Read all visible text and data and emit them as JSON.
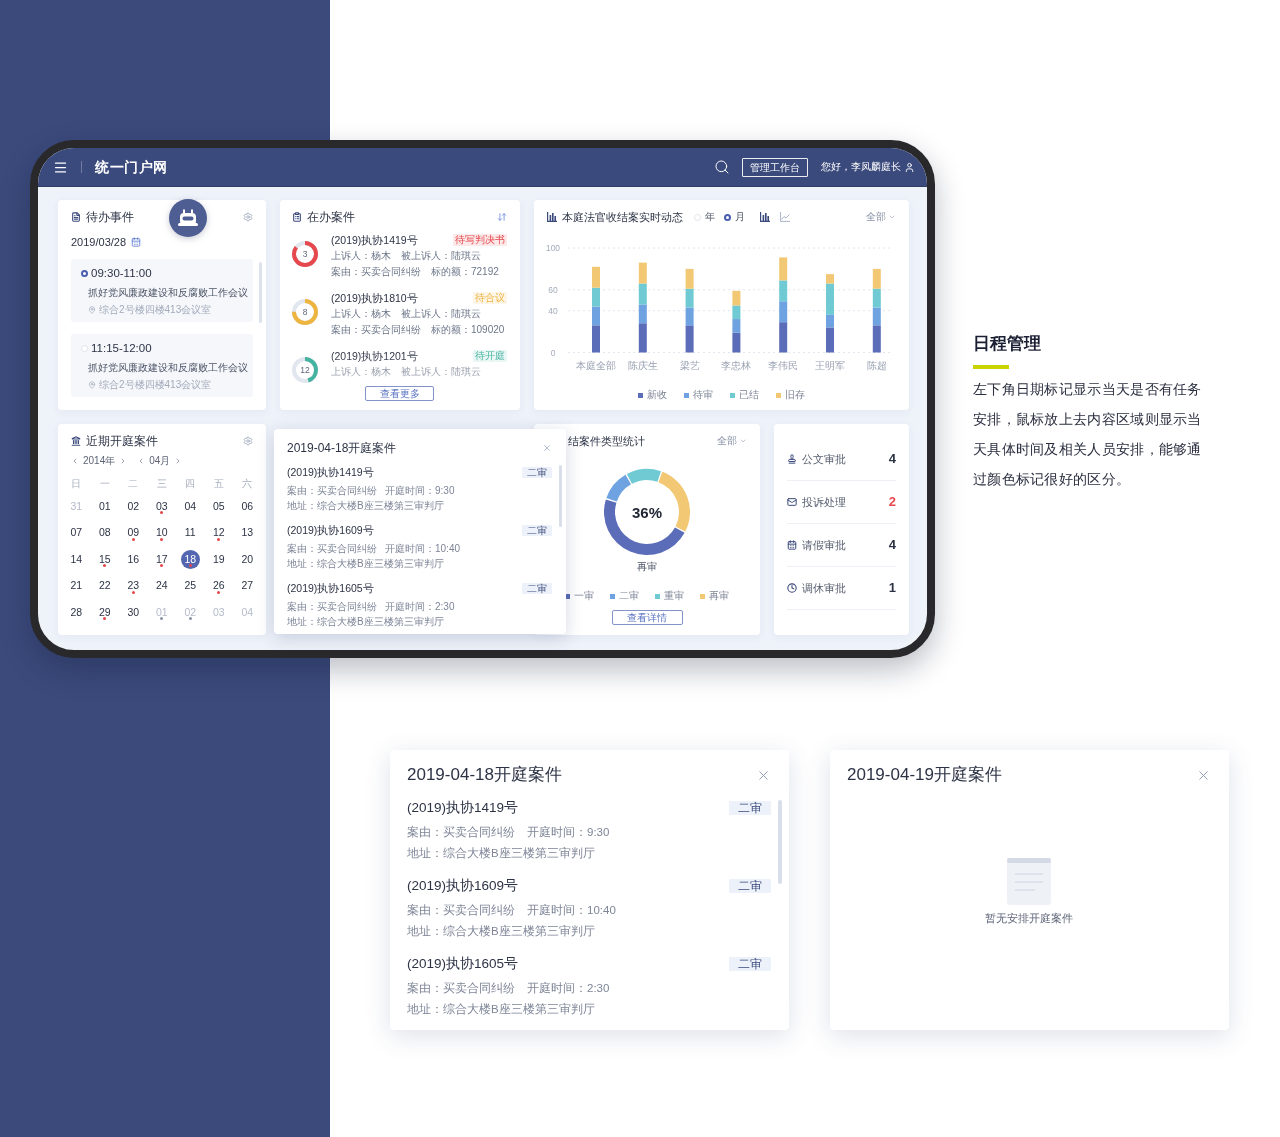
{
  "header": {
    "title": "统一门户网",
    "button": "管理工作台",
    "greeting": "您好，李凤麟庭长"
  },
  "todo": {
    "title": "待办事件",
    "date": "2019/03/28",
    "events": [
      {
        "time": "09:30-11:00",
        "title": "抓好党风廉政建设和反腐败工作会议",
        "location": "综合2号楼四楼413会议室",
        "selected": true
      },
      {
        "time": "11:15-12:00",
        "title": "抓好党风廉政建设和反腐败工作会议",
        "location": "综合2号楼四楼413会议室",
        "selected": false
      }
    ]
  },
  "cases": {
    "title": "在办案件",
    "items": [
      {
        "count": "3",
        "level": 0.85,
        "color": "#e5484d",
        "number": "(2019)执协1419号",
        "status": "待写判决书",
        "appellant": "上诉人：杨木",
        "appellee": "被上诉人：陆琪云",
        "cause": "案由：买卖合同纠纷",
        "amount": "标的额：72192"
      },
      {
        "count": "8",
        "level": 0.75,
        "color": "#eeb440",
        "number": "(2019)执协1810号",
        "status": "待合议",
        "appellant": "上诉人：杨木",
        "appellee": "被上诉人：陆琪云",
        "cause": "案由：买卖合同纠纷",
        "amount": "标的额：109020"
      },
      {
        "count": "12",
        "level": 0.45,
        "color": "#45b3a0",
        "number": "(2019)执协1201号",
        "status": "待开庭",
        "appellant": "上诉人：杨木",
        "appellee": "被上诉人：陆琪云"
      }
    ],
    "more_button": "查看更多"
  },
  "trend": {
    "title": "本庭法官收结案实时动态",
    "periods": [
      {
        "label": "年",
        "selected": false
      },
      {
        "label": "月",
        "selected": true
      }
    ],
    "views": [
      {
        "kind": "bar",
        "selected": true
      },
      {
        "kind": "line",
        "selected": false
      }
    ],
    "filter": "全部",
    "chart_data": {
      "type": "bar",
      "stacked": true,
      "categories": [
        "本庭全部",
        "陈庆生",
        "梁艺",
        "李忠林",
        "李伟民",
        "王明军",
        "陈超"
      ],
      "series": [
        {
          "name": "新收",
          "color": "#5b6cb8",
          "values": [
            26,
            28,
            26,
            19,
            29,
            24,
            26
          ]
        },
        {
          "name": "待审",
          "color": "#6ea2e0",
          "values": [
            18,
            18,
            17,
            13,
            20,
            12,
            17
          ]
        },
        {
          "name": "已结",
          "color": "#6fcad4",
          "values": [
            18,
            20,
            18,
            13,
            20,
            30,
            18
          ]
        },
        {
          "name": "旧存",
          "color": "#f2c874",
          "values": [
            20,
            20,
            19,
            14,
            22,
            9,
            19
          ]
        }
      ],
      "ylim": [
        0,
        100
      ],
      "yticks": [
        0,
        40,
        60,
        100
      ],
      "legend": "bottom"
    }
  },
  "court_calendar": {
    "title": "近期开庭案件",
    "year": "2014年",
    "month": "04月",
    "weekdays": [
      "日",
      "一",
      "二",
      "三",
      "四",
      "五",
      "六"
    ],
    "days": [
      {
        "day": "31",
        "outside": true,
        "marked": false,
        "selected": false
      },
      {
        "day": "01",
        "outside": false,
        "marked": false,
        "selected": false
      },
      {
        "day": "02",
        "outside": false,
        "marked": false,
        "selected": false
      },
      {
        "day": "03",
        "outside": false,
        "marked": true,
        "selected": false
      },
      {
        "day": "04",
        "outside": false,
        "marked": false,
        "selected": false
      },
      {
        "day": "05",
        "outside": false,
        "marked": false,
        "selected": false
      },
      {
        "day": "06",
        "outside": false,
        "marked": false,
        "selected": false
      },
      {
        "day": "07",
        "outside": false,
        "marked": false,
        "selected": false
      },
      {
        "day": "08",
        "outside": false,
        "marked": false,
        "selected": false
      },
      {
        "day": "09",
        "outside": false,
        "marked": true,
        "selected": false
      },
      {
        "day": "10",
        "outside": false,
        "marked": true,
        "selected": false
      },
      {
        "day": "11",
        "outside": false,
        "marked": false,
        "selected": false
      },
      {
        "day": "12",
        "outside": false,
        "marked": true,
        "selected": false
      },
      {
        "day": "13",
        "outside": false,
        "marked": false,
        "selected": false
      },
      {
        "day": "14",
        "outside": false,
        "marked": false,
        "selected": false
      },
      {
        "day": "15",
        "outside": false,
        "marked": true,
        "selected": false
      },
      {
        "day": "16",
        "outside": false,
        "marked": false,
        "selected": false
      },
      {
        "day": "17",
        "outside": false,
        "marked": true,
        "selected": false
      },
      {
        "day": "18",
        "outside": false,
        "marked": true,
        "selected": true
      },
      {
        "day": "19",
        "outside": false,
        "marked": false,
        "selected": false
      },
      {
        "day": "20",
        "outside": false,
        "marked": false,
        "selected": false
      },
      {
        "day": "21",
        "outside": false,
        "marked": false,
        "selected": false
      },
      {
        "day": "22",
        "outside": false,
        "marked": false,
        "selected": false
      },
      {
        "day": "23",
        "outside": false,
        "marked": true,
        "selected": false
      },
      {
        "day": "24",
        "outside": false,
        "marked": false,
        "selected": false
      },
      {
        "day": "25",
        "outside": false,
        "marked": false,
        "selected": false
      },
      {
        "day": "26",
        "outside": false,
        "marked": true,
        "selected": false
      },
      {
        "day": "27",
        "outside": false,
        "marked": false,
        "selected": false
      },
      {
        "day": "28",
        "outside": false,
        "marked": false,
        "selected": false
      },
      {
        "day": "29",
        "outside": false,
        "marked": true,
        "selected": false
      },
      {
        "day": "30",
        "outside": false,
        "marked": false,
        "selected": false
      },
      {
        "day": "01",
        "outside": true,
        "marked": true,
        "selected": false
      },
      {
        "day": "02",
        "outside": true,
        "marked": true,
        "selected": false
      },
      {
        "day": "03",
        "outside": true,
        "marked": false,
        "selected": false
      },
      {
        "day": "04",
        "outside": true,
        "marked": false,
        "selected": false
      }
    ]
  },
  "day_popup": {
    "title": "2019-04-18开庭案件",
    "cases": [
      {
        "number": "(2019)执协1419号",
        "stage": "二审",
        "cause": "案由：买卖合同纠纷",
        "time": "开庭时间：9:30",
        "address": "地址：综合大楼B座三楼第三审判厅"
      },
      {
        "number": "(2019)执协1609号",
        "stage": "二审",
        "cause": "案由：买卖合同纠纷",
        "time": "开庭时间：10:40",
        "address": "地址：综合大楼B座三楼第三审判厅"
      },
      {
        "number": "(2019)执协1605号",
        "stage": "二审",
        "cause": "案由：买卖合同纠纷",
        "time": "开庭时间：2:30",
        "address": "地址：综合大楼B座三楼第三审判厅"
      }
    ]
  },
  "case_types": {
    "title": "结案件类型统计",
    "filter": "全部",
    "center_value": "36%",
    "center_label": "再审",
    "legend": [
      {
        "label": "一审",
        "color": "#5b6cb8"
      },
      {
        "label": "二审",
        "color": "#6ea2e0"
      },
      {
        "label": "重审",
        "color": "#6fcad4"
      },
      {
        "label": "再审",
        "color": "#f2c874"
      }
    ],
    "button": "查看详情"
  },
  "approvals": [
    {
      "label": "公文审批",
      "count": "4",
      "highlight": false
    },
    {
      "label": "投诉处理",
      "count": "2",
      "highlight": true
    },
    {
      "label": "请假审批",
      "count": "4",
      "highlight": false
    },
    {
      "label": "调休审批",
      "count": "1",
      "highlight": false
    }
  ],
  "note": {
    "title": "日程管理",
    "text": "左下角日期标记显示当天是否有任务安排，鼠标放上去内容区域则显示当天具体时间及相关人员安排，能够通过颜色标记很好的区分。"
  },
  "popups": [
    {
      "title": "2019-04-18开庭案件",
      "cases": [
        {
          "number": "(2019)执协1419号",
          "stage": "二审",
          "cause": "案由：买卖合同纠纷",
          "time": "开庭时间：9:30",
          "address": "地址：综合大楼B座三楼第三审判厅"
        },
        {
          "number": "(2019)执协1609号",
          "stage": "二审",
          "cause": "案由：买卖合同纠纷",
          "time": "开庭时间：10:40",
          "address": "地址：综合大楼B座三楼第三审判厅"
        },
        {
          "number": "(2019)执协1605号",
          "stage": "二审",
          "cause": "案由：买卖合同纠纷",
          "time": "开庭时间：2:30",
          "address": "地址：综合大楼B座三楼第三审判厅"
        }
      ]
    },
    {
      "title": "2019-04-19开庭案件",
      "empty_text": "暂无安排开庭案件"
    }
  ]
}
